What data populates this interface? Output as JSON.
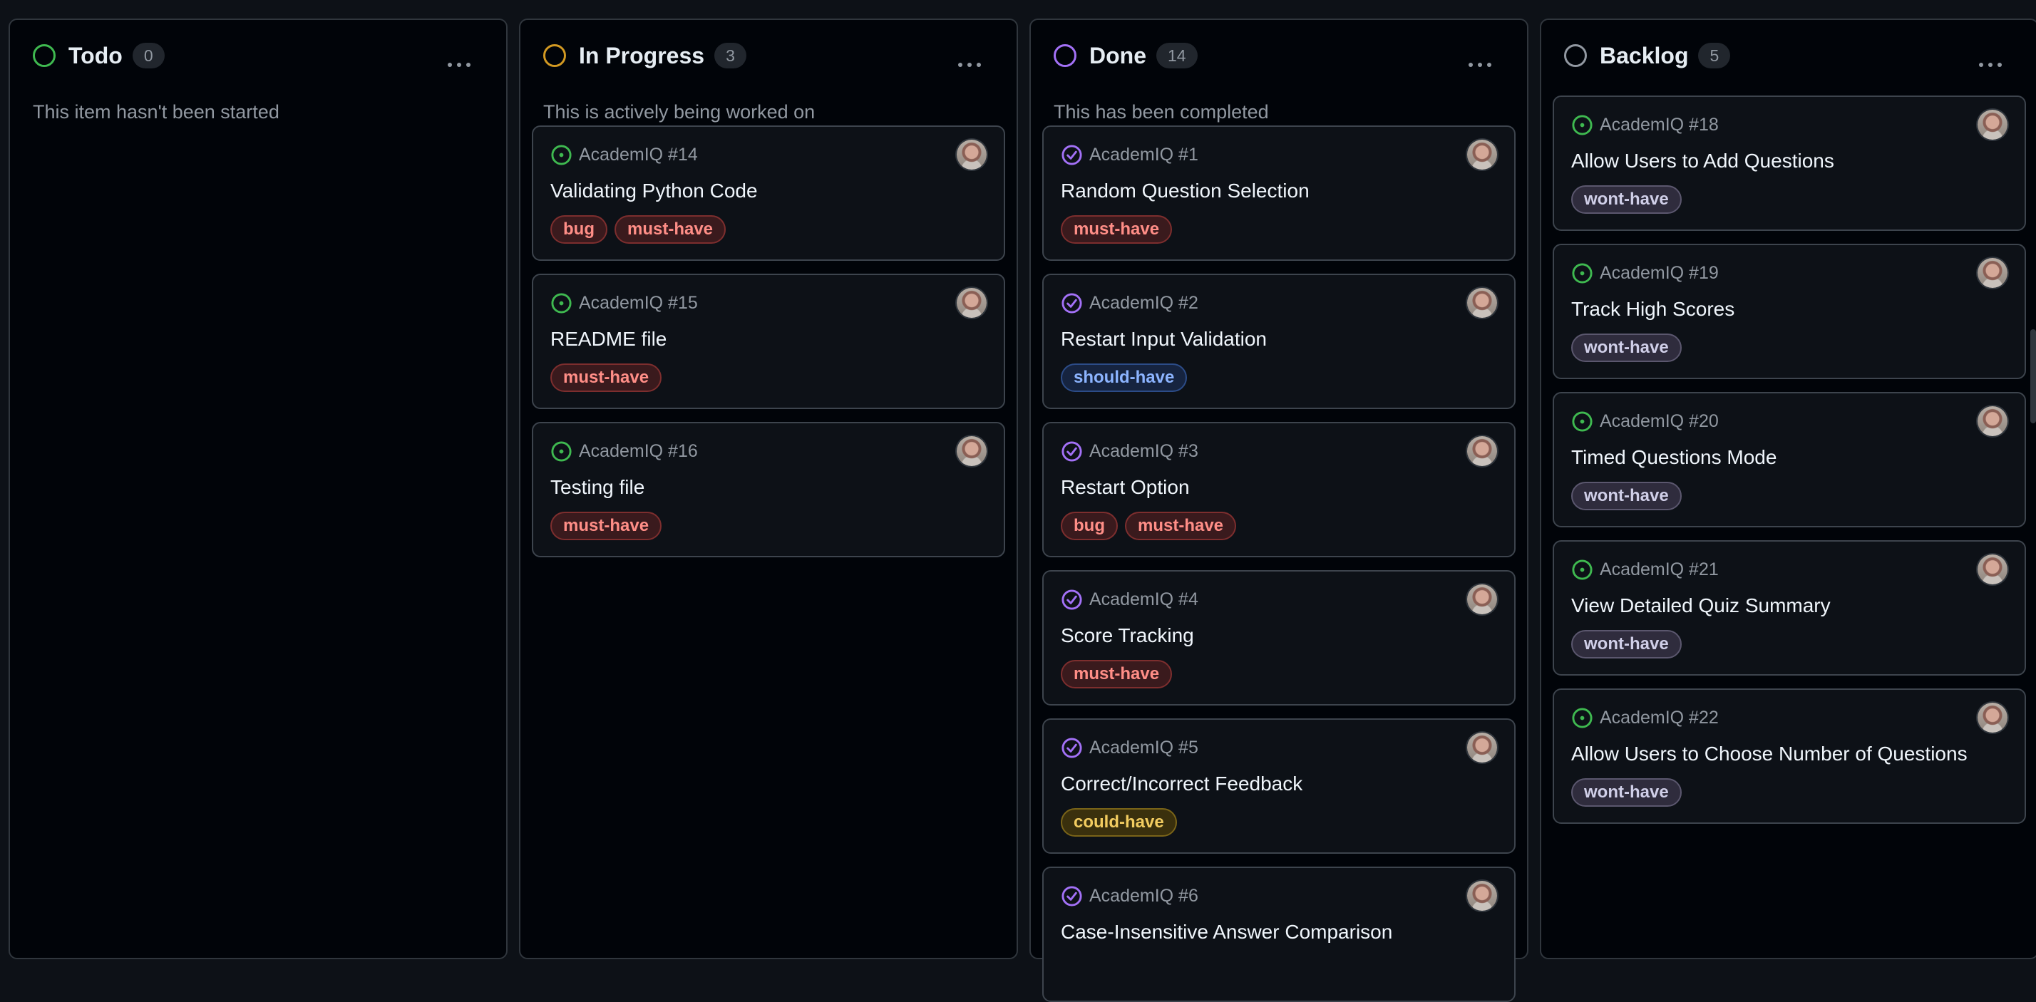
{
  "colors": {
    "todo": "#3fb950",
    "in_progress": "#d29922",
    "done": "#a371f7",
    "backlog": "#9198a1",
    "open_issue": "#3fb950",
    "closed_issue": "#a371f7"
  },
  "columns": [
    {
      "title": "Todo",
      "count": "0",
      "description": "This item hasn't been started",
      "status_icon": "todo-status-icon",
      "cards": []
    },
    {
      "title": "In Progress",
      "count": "3",
      "description": "This is actively being worked on",
      "status_icon": "in-progress-status-icon",
      "cards": [
        {
          "ref": "AcademIQ #14",
          "title": "Validating Python Code",
          "state_icon": "issue-open-icon",
          "labels": [
            "bug",
            "must-have"
          ]
        },
        {
          "ref": "AcademIQ #15",
          "title": "README file",
          "state_icon": "issue-open-icon",
          "labels": [
            "must-have"
          ]
        },
        {
          "ref": "AcademIQ #16",
          "title": "Testing file",
          "state_icon": "issue-open-icon",
          "labels": [
            "must-have"
          ]
        }
      ]
    },
    {
      "title": "Done",
      "count": "14",
      "description": "This has been completed",
      "status_icon": "done-status-icon",
      "cards": [
        {
          "ref": "AcademIQ #1",
          "title": "Random Question Selection",
          "state_icon": "issue-closed-icon",
          "labels": [
            "must-have"
          ]
        },
        {
          "ref": "AcademIQ #2",
          "title": "Restart Input Validation",
          "state_icon": "issue-closed-icon",
          "labels": [
            "should-have"
          ]
        },
        {
          "ref": "AcademIQ #3",
          "title": "Restart Option",
          "state_icon": "issue-closed-icon",
          "labels": [
            "bug",
            "must-have"
          ]
        },
        {
          "ref": "AcademIQ #4",
          "title": "Score Tracking",
          "state_icon": "issue-closed-icon",
          "labels": [
            "must-have"
          ]
        },
        {
          "ref": "AcademIQ #5",
          "title": "Correct/Incorrect Feedback",
          "state_icon": "issue-closed-icon",
          "labels": [
            "could-have"
          ]
        },
        {
          "ref": "AcademIQ #6",
          "title": "Case-Insensitive Answer Comparison",
          "state_icon": "issue-closed-icon",
          "labels": []
        }
      ]
    },
    {
      "title": "Backlog",
      "count": "5",
      "description": "",
      "status_icon": "backlog-status-icon",
      "cards": [
        {
          "ref": "AcademIQ #18",
          "title": "Allow Users to Add Questions",
          "state_icon": "issue-open-icon",
          "labels": [
            "wont-have"
          ]
        },
        {
          "ref": "AcademIQ #19",
          "title": "Track High Scores",
          "state_icon": "issue-open-icon",
          "labels": [
            "wont-have"
          ]
        },
        {
          "ref": "AcademIQ #20",
          "title": "Timed Questions Mode",
          "state_icon": "issue-open-icon",
          "labels": [
            "wont-have"
          ]
        },
        {
          "ref": "AcademIQ #21",
          "title": "View Detailed Quiz Summary",
          "state_icon": "issue-open-icon",
          "labels": [
            "wont-have"
          ]
        },
        {
          "ref": "AcademIQ #22",
          "title": "Allow Users to Choose Number of Questions",
          "state_icon": "issue-open-icon",
          "labels": [
            "wont-have"
          ]
        }
      ]
    }
  ]
}
